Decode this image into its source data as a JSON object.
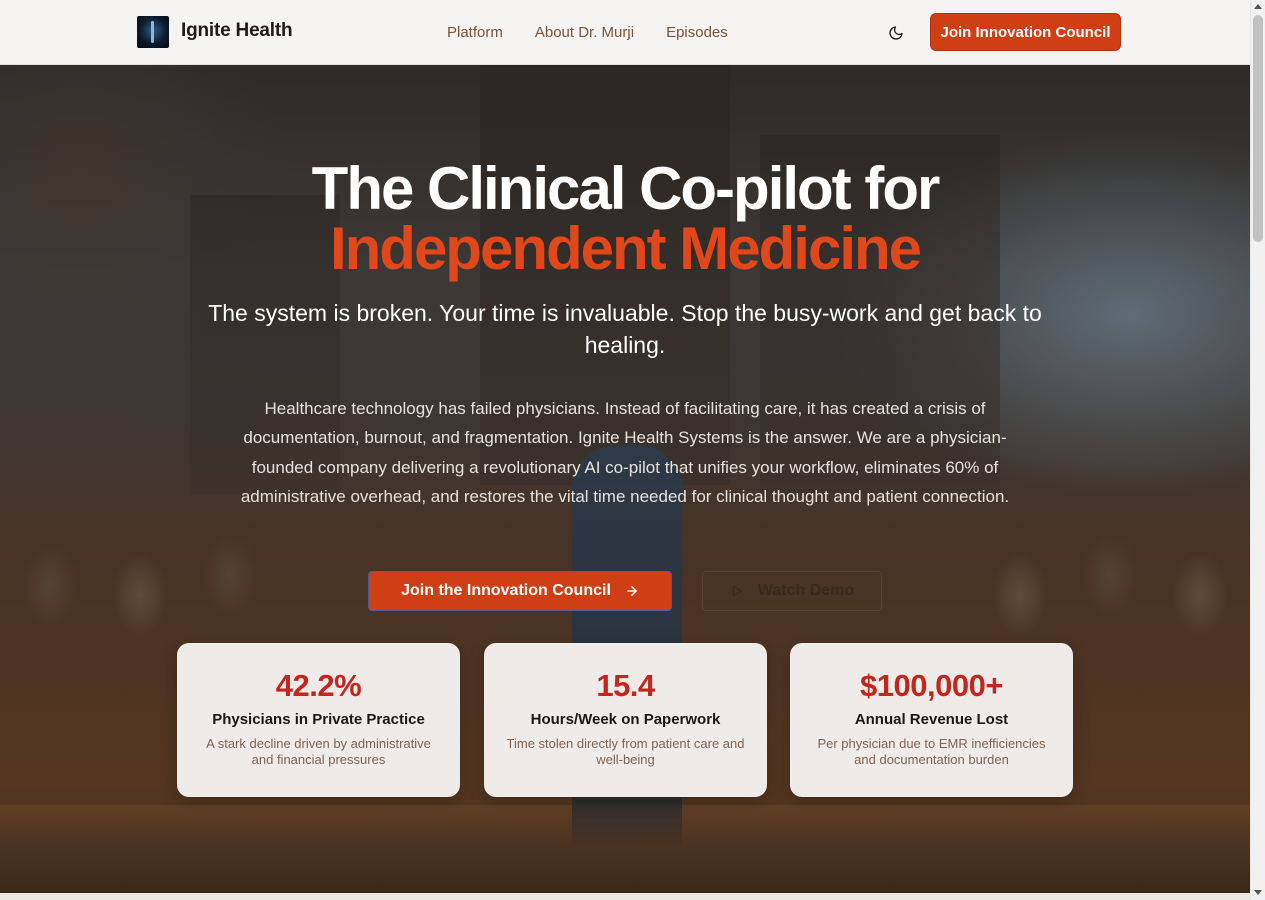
{
  "header": {
    "logo_alt": "Ignite Health logo",
    "brand": "Ignite Health",
    "nav": [
      {
        "label": "Platform"
      },
      {
        "label": "About Dr. Murji"
      },
      {
        "label": "Episodes"
      }
    ],
    "theme_icon": "moon-icon",
    "cta_label": "Join Innovation Council"
  },
  "hero": {
    "title_line1": "The Clinical Co-pilot for",
    "title_line2": "Independent Medicine",
    "subtitle": "The system is broken. Your time is invaluable. Stop the busy-work and get back to healing.",
    "body": "Healthcare technology has failed physicians. Instead of facilitating care, it has created a crisis of documentation, burnout, and fragmentation. Ignite Health Systems is the answer. We are a physician-founded company delivering a revolutionary AI co-pilot that unifies your workflow, eliminates 60% of administrative overhead, and restores the vital time needed for clinical thought and patient connection.",
    "primary_cta": "Join the Innovation Council",
    "primary_cta_icon": "arrow-right-icon",
    "secondary_cta": "Watch Demo",
    "secondary_cta_icon": "play-icon"
  },
  "stats": [
    {
      "value": "42.2%",
      "label": "Physicians in Private Practice",
      "desc": "A stark decline driven by administrative and financial pressures"
    },
    {
      "value": "15.4",
      "label": "Hours/Week on Paperwork",
      "desc": "Time stolen directly from patient care and well-being"
    },
    {
      "value": "$100,000+",
      "label": "Annual Revenue Lost",
      "desc": "Per physician due to EMR inefficiencies and documentation burden"
    }
  ],
  "colors": {
    "accent": "#cf3e14",
    "headline_accent": "#e0481b",
    "stat_value": "#c2261f"
  }
}
